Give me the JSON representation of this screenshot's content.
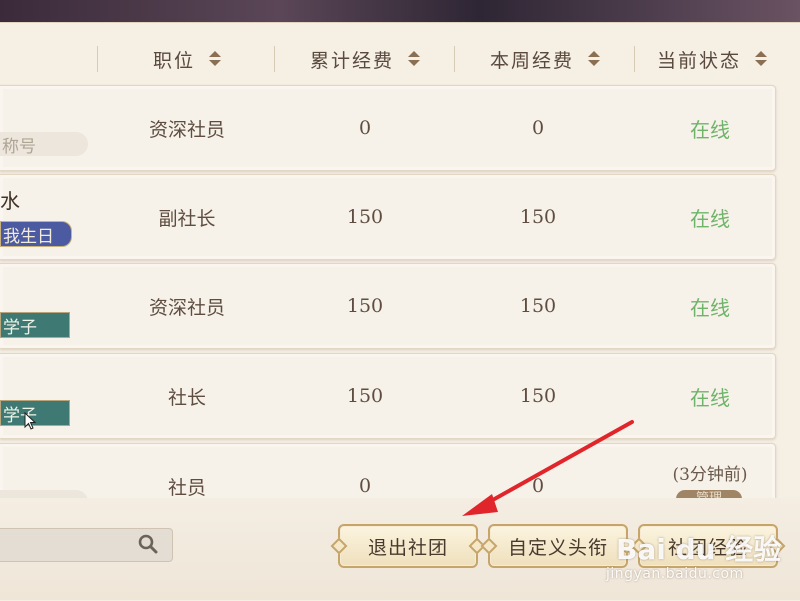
{
  "header": {
    "columns": [
      {
        "label": "职位"
      },
      {
        "label": "累计经费"
      },
      {
        "label": "本周经费"
      },
      {
        "label": "当前状态"
      }
    ]
  },
  "rows": [
    {
      "name_fragment": "",
      "tag": "称号",
      "tag_style": "gray",
      "position": "资深社员",
      "total": "0",
      "weekly": "0",
      "status": "在线"
    },
    {
      "name_fragment": "水",
      "tag": "我生日",
      "tag_style": "blue",
      "position": "副社长",
      "total": "150",
      "weekly": "150",
      "status": "在线"
    },
    {
      "name_fragment": "",
      "tag": "学子",
      "tag_style": "teal",
      "position": "资深社员",
      "total": "150",
      "weekly": "150",
      "status": "在线"
    },
    {
      "name_fragment": "",
      "tag": "学子",
      "tag_style": "teal",
      "position": "社长",
      "total": "150",
      "weekly": "150",
      "status": "在线"
    },
    {
      "name_fragment": "",
      "tag": "",
      "tag_style": "gray",
      "position": "社员",
      "total": "0",
      "weekly": "0",
      "status": "(3分钟前)",
      "status_chip": "管理"
    }
  ],
  "footer": {
    "search_placeholder": "",
    "buttons": {
      "leave": "退出社团",
      "custom_title": "自定义头衔",
      "experience": "社团经验"
    }
  },
  "watermark": {
    "brand": "Bai du 经验",
    "url": "jingyan.baidu.com"
  },
  "colors": {
    "online": "#6fb46a",
    "accent_gold": "#c6a56a",
    "arrow": "#e0262b"
  }
}
